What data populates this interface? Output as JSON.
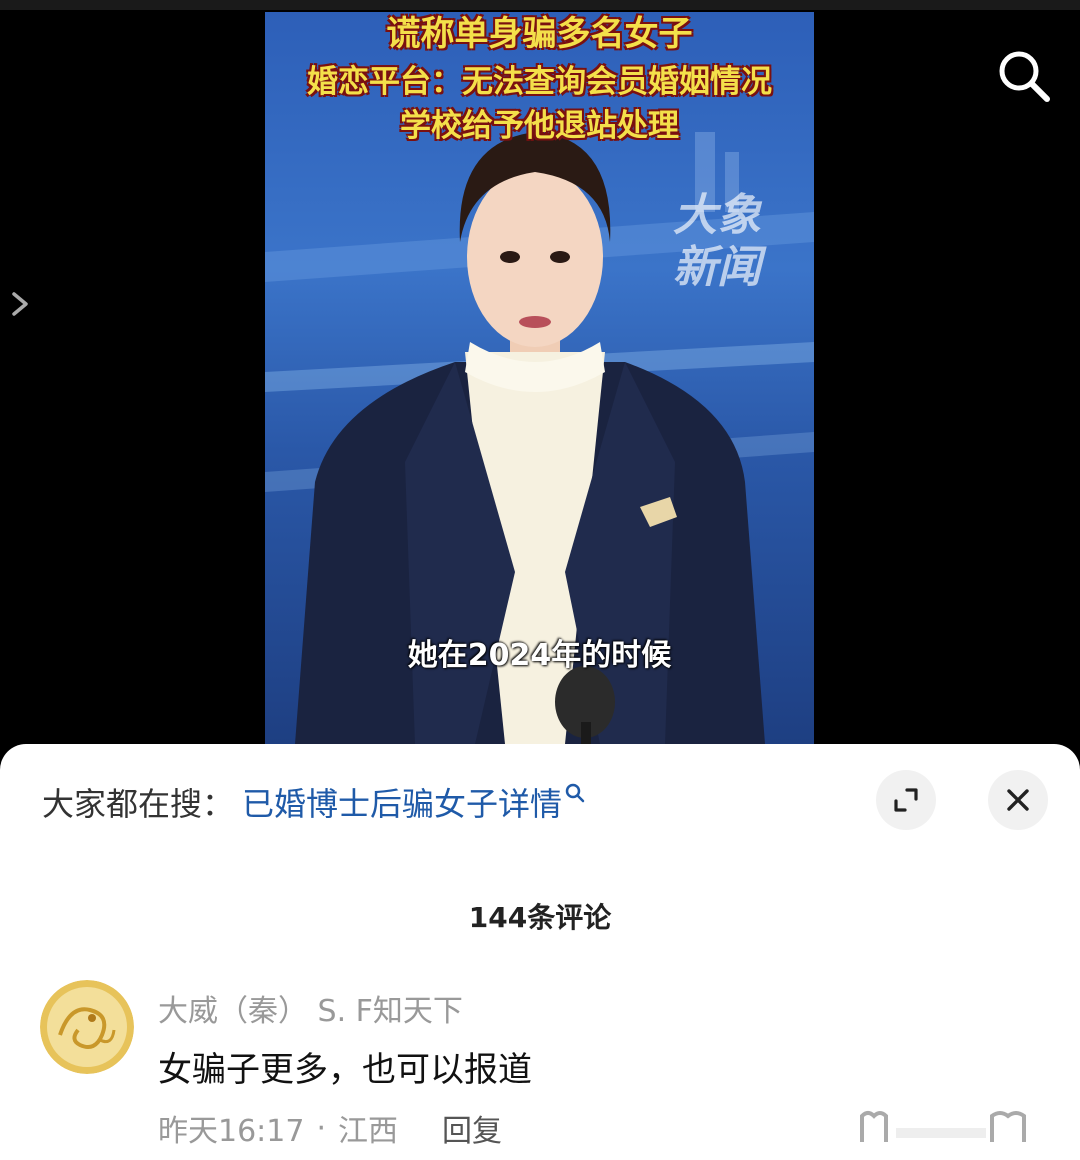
{
  "video": {
    "headline_1": "谎称单身骗多名女子",
    "headline_2": "婚恋平台：无法查询会员婚姻情况",
    "headline_3": "学校给予他退站处理",
    "watermark": "大象新闻",
    "subtitle": "她在2024年的时候"
  },
  "search_bar": {
    "prefix": "大家都在搜：",
    "term": "已婚博士后骗女子详情"
  },
  "comments_header": {
    "count_label": "144条评论"
  },
  "comment": {
    "author": "大威（秦） S. F知天下",
    "text": "女骗子更多，也可以报道",
    "time": "昨天16:17",
    "separator": "·",
    "location": "江西",
    "reply_label": "回复"
  },
  "icons": {
    "search": "search-icon",
    "side_arrow": "chevron-right-icon",
    "expand": "expand-icon",
    "close": "close-icon",
    "avatar": "dragon-avatar"
  },
  "colors": {
    "link": "#1f5aa8",
    "headline": "#f4e04a",
    "muted": "#999999"
  }
}
